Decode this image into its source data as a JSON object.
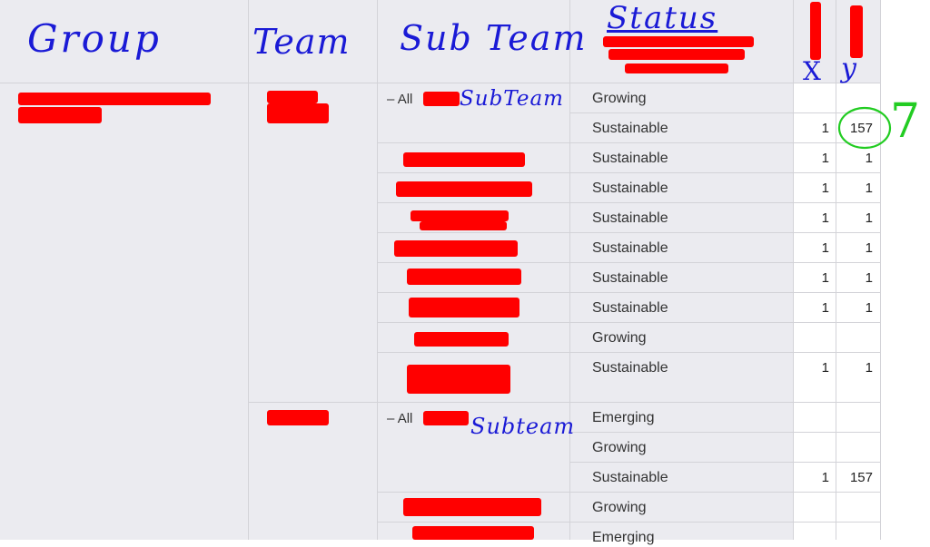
{
  "header": {
    "group": "Group",
    "team": "Team",
    "subteam": "Sub Team",
    "status": "Status",
    "x": "X",
    "y": "y"
  },
  "blocks": [
    {
      "all_label": "All",
      "subteam_note": "SubTeam",
      "rows": [
        {
          "status": "Growing",
          "x": "",
          "y": ""
        },
        {
          "status": "Sustainable",
          "x": "1",
          "y": "157"
        },
        {
          "status": "Sustainable",
          "x": "1",
          "y": "1"
        },
        {
          "status": "Sustainable",
          "x": "1",
          "y": "1"
        },
        {
          "status": "Sustainable",
          "x": "1",
          "y": "1"
        },
        {
          "status": "Sustainable",
          "x": "1",
          "y": "1"
        },
        {
          "status": "Sustainable",
          "x": "1",
          "y": "1"
        },
        {
          "status": "Sustainable",
          "x": "1",
          "y": "1"
        },
        {
          "status": "Growing",
          "x": "",
          "y": ""
        },
        {
          "status": "Sustainable",
          "x": "1",
          "y": "1"
        }
      ]
    },
    {
      "all_label": "All",
      "subteam_note": "Subteam",
      "rows": [
        {
          "status": "Emerging",
          "x": "",
          "y": ""
        },
        {
          "status": "Growing",
          "x": "",
          "y": ""
        },
        {
          "status": "Sustainable",
          "x": "1",
          "y": "157"
        },
        {
          "status": "Growing",
          "x": "",
          "y": ""
        },
        {
          "status": "Emerging",
          "x": "",
          "y": ""
        }
      ]
    }
  ],
  "annotation": {
    "circled_value": "157",
    "side_note": "7",
    "color": "#22cc22"
  },
  "colors": {
    "cell_bg": "#ebebf0",
    "grid": "#d3d3d8",
    "handwriting": "#1a1ad6",
    "redaction": "#ff0000"
  }
}
